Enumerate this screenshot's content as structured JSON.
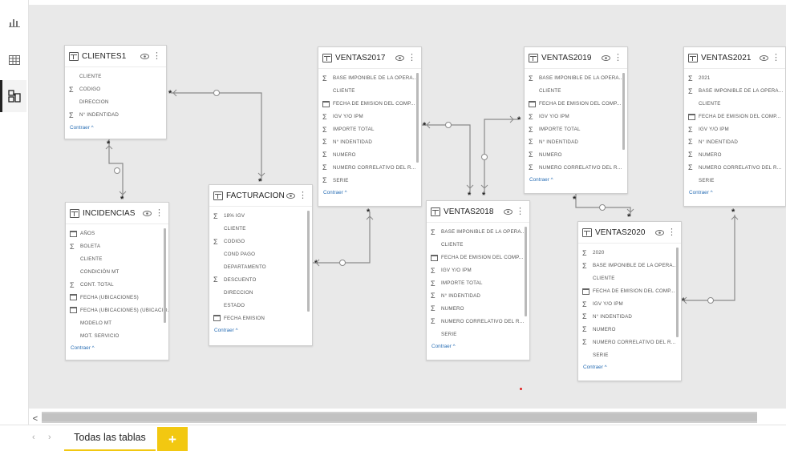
{
  "left_rail": {
    "items": [
      {
        "name": "report-view-icon",
        "active": false
      },
      {
        "name": "data-view-icon",
        "active": false
      },
      {
        "name": "model-view-icon",
        "active": true
      }
    ]
  },
  "tables": {
    "clientes1": {
      "title": "CLIENTES1",
      "fields": [
        {
          "icon": "",
          "name": "CLIENTE"
        },
        {
          "icon": "sigma",
          "name": "CODIGO"
        },
        {
          "icon": "",
          "name": "DIRECCION"
        },
        {
          "icon": "sigma",
          "name": "N° INDENTIDAD"
        }
      ],
      "collapse": "Contraer ^"
    },
    "incidencias": {
      "title": "INCIDENCIAS",
      "fields": [
        {
          "icon": "calendar",
          "name": "AÑOS"
        },
        {
          "icon": "sigma",
          "name": "BOLETA"
        },
        {
          "icon": "",
          "name": "CLIENTE"
        },
        {
          "icon": "",
          "name": "CONDICIÓN MT"
        },
        {
          "icon": "sigma",
          "name": "CONT. TOTAL"
        },
        {
          "icon": "calendar",
          "name": "FECHA (ubicaciones)"
        },
        {
          "icon": "calendar",
          "name": "FECHA (ubicaciones) (ubicacio..."
        },
        {
          "icon": "",
          "name": "MODELO MT"
        },
        {
          "icon": "",
          "name": "MOT. SERVICIO"
        }
      ],
      "collapse": "Contraer ^"
    },
    "facturacion": {
      "title": "FACTURACION",
      "fields": [
        {
          "icon": "sigma",
          "name": "18% IGV"
        },
        {
          "icon": "",
          "name": "CLIENTE"
        },
        {
          "icon": "sigma",
          "name": "CODIGO"
        },
        {
          "icon": "",
          "name": "COND PAGO"
        },
        {
          "icon": "",
          "name": "DEPARTAMENTO"
        },
        {
          "icon": "sigma",
          "name": "DESCUENTO"
        },
        {
          "icon": "",
          "name": "DIRECCION"
        },
        {
          "icon": "",
          "name": "ESTADO"
        },
        {
          "icon": "calendar",
          "name": "FECHA EMISION"
        }
      ],
      "collapse": "Contraer ^"
    },
    "ventas2017": {
      "title": "VENTAS2017",
      "fields": [
        {
          "icon": "sigma",
          "name": "BASE IMPONIBLE DE LA OPERA..."
        },
        {
          "icon": "",
          "name": "CLIENTE"
        },
        {
          "icon": "calendar",
          "name": "FECHA DE EMISION DEL COMP..."
        },
        {
          "icon": "sigma",
          "name": "IGV Y/O IPM"
        },
        {
          "icon": "sigma",
          "name": "IMPORTE TOTAL"
        },
        {
          "icon": "sigma",
          "name": "N° INDENTIDAD"
        },
        {
          "icon": "sigma",
          "name": "NUMERO"
        },
        {
          "icon": "sigma",
          "name": "NUMERO CORRELATIVO DEL R..."
        },
        {
          "icon": "sigma",
          "name": "SERIE"
        }
      ],
      "collapse": "Contraer ^"
    },
    "ventas2018": {
      "title": "VENTAS2018",
      "fields": [
        {
          "icon": "sigma",
          "name": "BASE IMPONIBLE DE LA OPERA..."
        },
        {
          "icon": "",
          "name": "CLIENTE"
        },
        {
          "icon": "calendar",
          "name": "FECHA DE EMISION DEL COMP..."
        },
        {
          "icon": "sigma",
          "name": "IGV Y/O IPM"
        },
        {
          "icon": "sigma",
          "name": "IMPORTE TOTAL"
        },
        {
          "icon": "sigma",
          "name": "N° INDENTIDAD"
        },
        {
          "icon": "sigma",
          "name": "NUMERO"
        },
        {
          "icon": "sigma",
          "name": "NUMERO CORRELATIVO DEL R..."
        },
        {
          "icon": "",
          "name": "SERIE"
        }
      ],
      "collapse": "Contraer ^"
    },
    "ventas2019": {
      "title": "VENTAS2019",
      "fields": [
        {
          "icon": "sigma",
          "name": "BASE IMPONIBLE DE LA OPERA..."
        },
        {
          "icon": "",
          "name": "CLIENTE"
        },
        {
          "icon": "calendar",
          "name": "FECHA DE EMISION DEL COMP..."
        },
        {
          "icon": "sigma",
          "name": "IGV Y/O IPM"
        },
        {
          "icon": "sigma",
          "name": "IMPORTE TOTAL"
        },
        {
          "icon": "sigma",
          "name": "N° INDENTIDAD"
        },
        {
          "icon": "sigma",
          "name": "NUMERO"
        },
        {
          "icon": "sigma",
          "name": "NUMERO CORRELATIVO DEL R..."
        }
      ],
      "collapse": "Contraer ^"
    },
    "ventas2020": {
      "title": "VENTAS2020",
      "fields": [
        {
          "icon": "sigma",
          "name": "2020"
        },
        {
          "icon": "sigma",
          "name": "BASE IMPONIBLE DE LA OPERA..."
        },
        {
          "icon": "",
          "name": "CLIENTE"
        },
        {
          "icon": "calendar",
          "name": "FECHA DE EMISION DEL COMP..."
        },
        {
          "icon": "sigma",
          "name": "IGV Y/O IPM"
        },
        {
          "icon": "sigma",
          "name": "N° INDENTIDAD"
        },
        {
          "icon": "sigma",
          "name": "NUMERO"
        },
        {
          "icon": "sigma",
          "name": "NUMERO CORRELATIVO DEL R..."
        },
        {
          "icon": "",
          "name": "SERIE"
        }
      ],
      "collapse": "Contraer ^"
    },
    "ventas2021": {
      "title": "VENTAS2021",
      "fields": [
        {
          "icon": "sigma",
          "name": "2021"
        },
        {
          "icon": "sigma",
          "name": "BASE IMPONIBLE DE LA OPERA..."
        },
        {
          "icon": "",
          "name": "CLIENTE"
        },
        {
          "icon": "calendar",
          "name": "FECHA DE EMISION DEL COMP..."
        },
        {
          "icon": "sigma",
          "name": "IGV Y/O IPM"
        },
        {
          "icon": "sigma",
          "name": "N° INDENTIDAD"
        },
        {
          "icon": "sigma",
          "name": "NUMERO"
        },
        {
          "icon": "sigma",
          "name": "NUMERO CORRELATIVO DEL R..."
        },
        {
          "icon": "",
          "name": "SERIE"
        }
      ],
      "collapse": "Contraer ^"
    }
  },
  "relationships": [
    {
      "from": "clientes1",
      "to": "facturacion",
      "from_card": "*",
      "to_card": "*"
    },
    {
      "from": "clientes1",
      "to": "incidencias",
      "from_card": "*",
      "to_card": "*"
    },
    {
      "from": "facturacion",
      "to": "ventas2017",
      "from_card": "*",
      "to_card": "*"
    },
    {
      "from": "ventas2017",
      "to": "ventas2018",
      "from_card": "*",
      "to_card": "*"
    },
    {
      "from": "ventas2019",
      "to": "ventas2018",
      "from_card": "*",
      "to_card": "*"
    },
    {
      "from": "ventas2019",
      "to": "ventas2020",
      "from_card": "*",
      "to_card": "*"
    },
    {
      "from": "ventas2020",
      "to": "ventas2021",
      "from_card": "*",
      "to_card": "*"
    }
  ],
  "bottom": {
    "tab_label": "Todas las tablas",
    "add_label": "+",
    "prev_arrow": "‹",
    "next_arrow": "›",
    "scroll_left": "<"
  },
  "colors": {
    "accent": "#f2c811",
    "canvas": "#e9e9e9",
    "link": "#2a6fb5",
    "marker": "#e02020"
  }
}
